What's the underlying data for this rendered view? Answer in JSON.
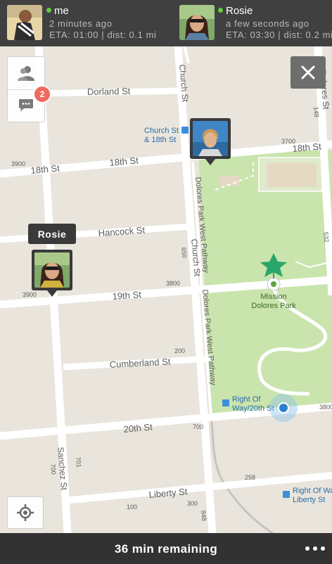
{
  "header": {
    "participants": [
      {
        "name": "me",
        "status_color": "#5fcf3a",
        "updated": "2 minutes ago",
        "eta_line": "ETA: 01:00 | dist: 0.1 mi"
      },
      {
        "name": "Rosie",
        "status_color": "#5fcf3a",
        "updated": "a few seconds ago",
        "eta_line": "ETA: 03:30 | dist: 0.2 mi"
      }
    ]
  },
  "controls": {
    "people_icon": "people-icon",
    "chat_icon": "chat-bubble-icon",
    "chat_badge": "2",
    "close_icon": "close-icon",
    "locate_icon": "crosshair-icon"
  },
  "map": {
    "pins": [
      {
        "label": "Rosie",
        "icon": "avatar-pin"
      },
      {
        "label": "",
        "icon": "avatar-pin"
      }
    ],
    "places": [
      {
        "name_line1": "Church St",
        "name_line2": "& 18th St"
      },
      {
        "name_line1": "Mission",
        "name_line2": "Dolores Park"
      },
      {
        "name_line1": "Right Of",
        "name_line2": "Way/20th St"
      },
      {
        "name_line1": "Right Of Way/",
        "name_line2": "Liberty St"
      }
    ],
    "streets": {
      "dorland": "Dorland St",
      "eighteenth_left": "18th St",
      "eighteenth_right": "18th St",
      "hancock": "Hancock St",
      "nineteenth": "19th St",
      "cumberland": "Cumberland St",
      "twentieth": "20th St",
      "liberty": "Liberty St",
      "church_top": "Church St",
      "church_mid": "Church St",
      "dolores_path_1": "Dolores Park West Pathway",
      "dolores_path_2": "Dolores Park West Pathway",
      "sanchez": "Sanchez St",
      "dolores_right": "Dolores St"
    },
    "numbers": [
      "3700",
      "3900",
      "3800",
      "3900",
      "3800",
      "650",
      "200",
      "700",
      "701",
      "700",
      "258",
      "300",
      "100",
      "148",
      "848",
      "532",
      "3700"
    ],
    "colors": {
      "land": "#e9e5dc",
      "road": "#ffffff",
      "park": "#c9e4ad",
      "transit_line": "#9c9c9c",
      "user_dot": "#2a7fc7"
    }
  },
  "footer": {
    "remaining": "36 min remaining",
    "more_icon": "more-dots-icon"
  }
}
